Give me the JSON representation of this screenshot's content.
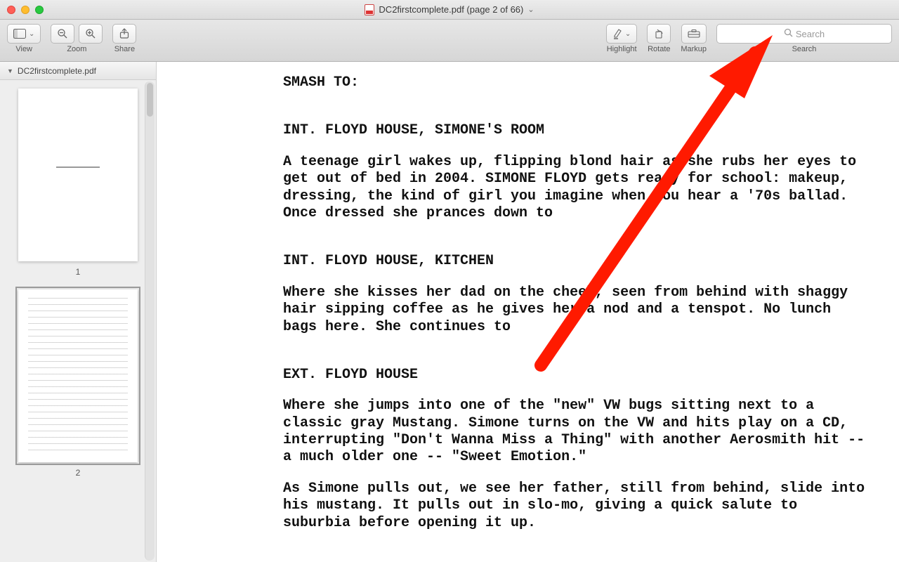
{
  "window": {
    "title": "DC2firstcomplete.pdf (page 2 of 66)"
  },
  "toolbar": {
    "view_label": "View",
    "zoom_label": "Zoom",
    "share_label": "Share",
    "highlight_label": "Highlight",
    "rotate_label": "Rotate",
    "markup_label": "Markup",
    "search_label": "Search",
    "search_placeholder": "Search"
  },
  "sidebar": {
    "filename": "DC2firstcomplete.pdf",
    "thumbs": [
      {
        "num": "1",
        "selected": false,
        "style": "title"
      },
      {
        "num": "2",
        "selected": true,
        "style": "text"
      }
    ]
  },
  "doc": {
    "smash": "SMASH TO:",
    "s1_slug": "INT. FLOYD HOUSE, SIMONE'S ROOM",
    "s1_p1": "A teenage girl wakes up, flipping blond hair as she rubs her eyes to get out of bed in 2004. SIMONE FLOYD gets ready for school: makeup, dressing, the kind of girl you imagine when you hear a '70s ballad. Once dressed she prances down to",
    "s2_slug": "INT. FLOYD HOUSE, KITCHEN",
    "s2_p1": "Where she kisses her dad on the cheek, seen from behind with shaggy hair sipping coffee as he gives her a nod and a tenspot. No lunch bags here. She continues to",
    "s3_slug": "EXT. FLOYD HOUSE",
    "s3_p1": "Where she jumps into one of the \"new\" VW bugs sitting next to a classic gray Mustang. Simone turns on the VW and hits play on a CD, interrupting \"Don't Wanna Miss a Thing\" with another Aerosmith hit -- a much older one -- \"Sweet Emotion.\"",
    "s3_p2": "As Simone pulls out, we see her father, still from behind, slide into his mustang. It pulls out in slo-mo, giving a quick salute to suburbia before opening it up."
  }
}
